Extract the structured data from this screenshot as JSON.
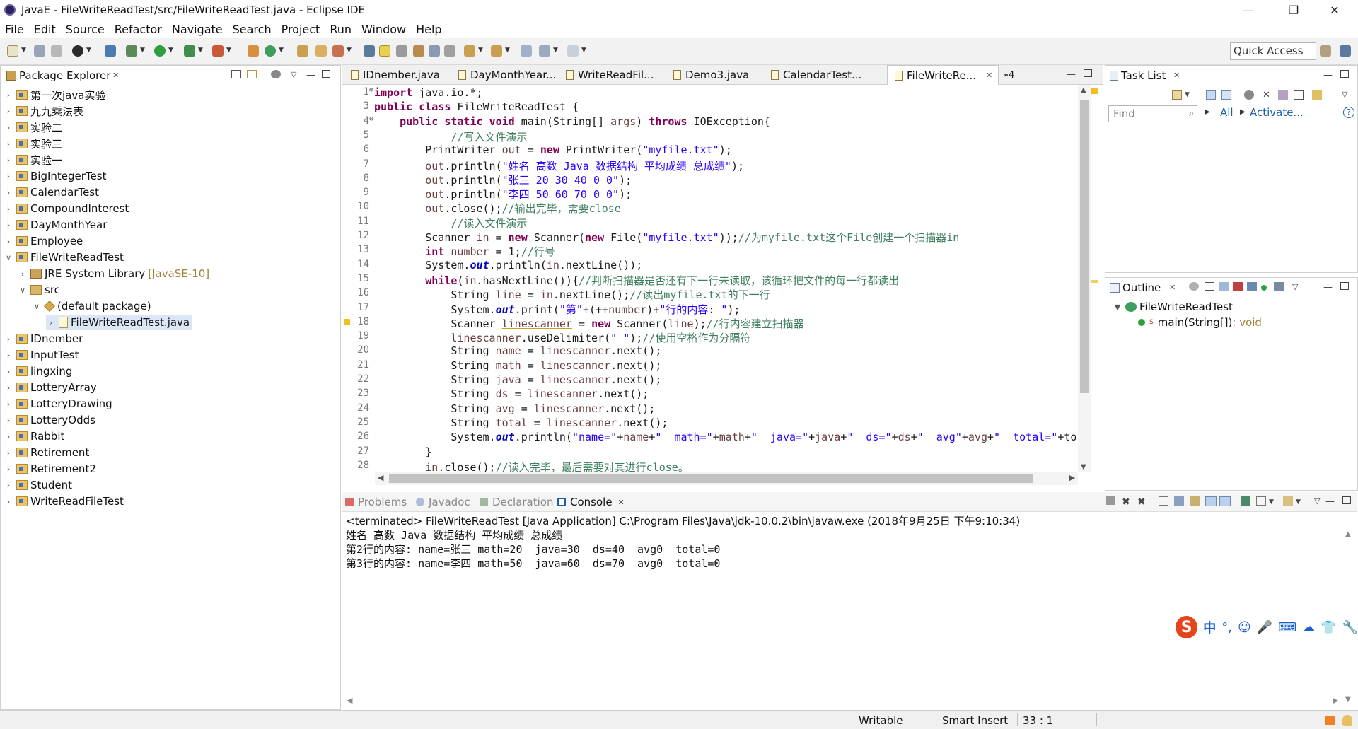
{
  "window": {
    "title": "JavaE - FileWriteReadTest/src/FileWriteReadTest.java - Eclipse IDE",
    "minimize": "—",
    "restore": "❐",
    "close": "✕"
  },
  "menu": [
    "File",
    "Edit",
    "Source",
    "Refactor",
    "Navigate",
    "Search",
    "Project",
    "Run",
    "Window",
    "Help"
  ],
  "quick_access": "Quick Access",
  "package_explorer": {
    "title": "Package Explorer",
    "items": [
      {
        "label": "第一次java实验",
        "kind": "project",
        "level": 0,
        "expanded": false
      },
      {
        "label": "九九乘法表",
        "kind": "project",
        "level": 0,
        "expanded": false
      },
      {
        "label": "实验二",
        "kind": "project",
        "level": 0,
        "expanded": false
      },
      {
        "label": "实验三",
        "kind": "project",
        "level": 0,
        "expanded": false
      },
      {
        "label": "实验一",
        "kind": "project",
        "level": 0,
        "expanded": false
      },
      {
        "label": "BigIntegerTest",
        "kind": "project",
        "level": 0,
        "expanded": false
      },
      {
        "label": "CalendarTest",
        "kind": "project",
        "level": 0,
        "expanded": false
      },
      {
        "label": "CompoundInterest",
        "kind": "project",
        "level": 0,
        "expanded": false
      },
      {
        "label": "DayMonthYear",
        "kind": "project",
        "level": 0,
        "expanded": false
      },
      {
        "label": "Employee",
        "kind": "project",
        "level": 0,
        "expanded": false
      },
      {
        "label": "FileWriteReadTest",
        "kind": "project",
        "level": 0,
        "expanded": true
      },
      {
        "label": "JRE System Library",
        "tag": "[JavaSE-10]",
        "kind": "library",
        "level": 1,
        "expanded": false
      },
      {
        "label": "src",
        "kind": "src",
        "level": 1,
        "expanded": true
      },
      {
        "label": "(default package)",
        "kind": "package",
        "level": 2,
        "expanded": true
      },
      {
        "label": "FileWriteReadTest.java",
        "kind": "java",
        "level": 3,
        "expanded": false,
        "selected": true
      },
      {
        "label": "IDnember",
        "kind": "project",
        "level": 0,
        "expanded": false
      },
      {
        "label": "InputTest",
        "kind": "project",
        "level": 0,
        "expanded": false
      },
      {
        "label": "lingxing",
        "kind": "project",
        "level": 0,
        "expanded": false
      },
      {
        "label": "LotteryArray",
        "kind": "project",
        "level": 0,
        "expanded": false
      },
      {
        "label": "LotteryDrawing",
        "kind": "project",
        "level": 0,
        "expanded": false
      },
      {
        "label": "LotteryOdds",
        "kind": "project",
        "level": 0,
        "expanded": false
      },
      {
        "label": "Rabbit",
        "kind": "project",
        "level": 0,
        "expanded": false
      },
      {
        "label": "Retirement",
        "kind": "project",
        "level": 0,
        "expanded": false
      },
      {
        "label": "Retirement2",
        "kind": "project",
        "level": 0,
        "expanded": false
      },
      {
        "label": "Student",
        "kind": "project",
        "level": 0,
        "expanded": false
      },
      {
        "label": "WriteReadFileTest",
        "kind": "project",
        "level": 0,
        "expanded": false
      }
    ]
  },
  "editor": {
    "tabs": [
      {
        "label": "IDnember.java",
        "active": false
      },
      {
        "label": "DayMonthYear...",
        "active": false
      },
      {
        "label": "WriteReadFil...",
        "active": false
      },
      {
        "label": "Demo3.java",
        "active": false
      },
      {
        "label": "CalendarTest...",
        "active": false
      },
      {
        "label": "FileWriteRe...",
        "active": true
      }
    ],
    "overflow": "»4",
    "lines": [
      {
        "n": "1",
        "marker": "⊕",
        "segs": [
          [
            "kw",
            "import"
          ],
          [
            "",
            " java.io.*;"
          ]
        ]
      },
      {
        "n": "3",
        "segs": [
          [
            "kw",
            "public"
          ],
          [
            "",
            " "
          ],
          [
            "kw",
            "class"
          ],
          [
            "",
            " FileWriteReadTest {"
          ]
        ]
      },
      {
        "n": "4",
        "marker": "⊖",
        "segs": [
          [
            "",
            "    "
          ],
          [
            "kw",
            "public"
          ],
          [
            "",
            " "
          ],
          [
            "kw",
            "static"
          ],
          [
            "",
            " "
          ],
          [
            "kw",
            "void"
          ],
          [
            "",
            " main(String[] "
          ],
          [
            "var",
            "args"
          ],
          [
            "",
            ") "
          ],
          [
            "kw",
            "throws"
          ],
          [
            "",
            " IOException{"
          ]
        ]
      },
      {
        "n": "5",
        "segs": [
          [
            "",
            "            "
          ],
          [
            "cmt",
            "//写入文件演示"
          ]
        ]
      },
      {
        "n": "6",
        "segs": [
          [
            "",
            "        PrintWriter "
          ],
          [
            "var",
            "out"
          ],
          [
            "",
            " = "
          ],
          [
            "kw",
            "new"
          ],
          [
            "",
            " PrintWriter("
          ],
          [
            "str",
            "\"myfile.txt\""
          ],
          [
            "",
            ");"
          ]
        ]
      },
      {
        "n": "7",
        "segs": [
          [
            "",
            "        "
          ],
          [
            "var",
            "out"
          ],
          [
            "",
            ".println("
          ],
          [
            "str",
            "\"姓名 高数 Java 数据结构 平均成绩 总成绩\""
          ],
          [
            "",
            ");"
          ]
        ]
      },
      {
        "n": "8",
        "segs": [
          [
            "",
            "        "
          ],
          [
            "var",
            "out"
          ],
          [
            "",
            ".println("
          ],
          [
            "str",
            "\"张三 20 30 40 0 0\""
          ],
          [
            "",
            ");"
          ]
        ]
      },
      {
        "n": "9",
        "segs": [
          [
            "",
            "        "
          ],
          [
            "var",
            "out"
          ],
          [
            "",
            ".println("
          ],
          [
            "str",
            "\"李四 50 60 70 0 0\""
          ],
          [
            "",
            ");"
          ]
        ]
      },
      {
        "n": "10",
        "segs": [
          [
            "",
            "        "
          ],
          [
            "var",
            "out"
          ],
          [
            "",
            ".close();"
          ],
          [
            "cmt",
            "//输出完毕，需要close"
          ]
        ]
      },
      {
        "n": "11",
        "segs": [
          [
            "",
            "            "
          ],
          [
            "cmt",
            "//读入文件演示"
          ]
        ]
      },
      {
        "n": "12",
        "segs": [
          [
            "",
            "        Scanner "
          ],
          [
            "var",
            "in"
          ],
          [
            "",
            " = "
          ],
          [
            "kw",
            "new"
          ],
          [
            "",
            " Scanner("
          ],
          [
            "kw",
            "new"
          ],
          [
            "",
            " File("
          ],
          [
            "str",
            "\"myfile.txt\""
          ],
          [
            "",
            "));"
          ],
          [
            "cmt",
            "//为myfile.txt这个File创建一个扫描器in"
          ]
        ]
      },
      {
        "n": "13",
        "segs": [
          [
            "",
            "        "
          ],
          [
            "kw",
            "int"
          ],
          [
            "",
            " "
          ],
          [
            "var",
            "number"
          ],
          [
            "",
            " = 1;"
          ],
          [
            "cmt",
            "//行号"
          ]
        ]
      },
      {
        "n": "14",
        "segs": [
          [
            "",
            "        System."
          ],
          [
            "sfld",
            "out"
          ],
          [
            "",
            ".println("
          ],
          [
            "var",
            "in"
          ],
          [
            "",
            ".nextLine());"
          ]
        ]
      },
      {
        "n": "15",
        "segs": [
          [
            "",
            "        "
          ],
          [
            "kw",
            "while"
          ],
          [
            "",
            "("
          ],
          [
            "var",
            "in"
          ],
          [
            "",
            ".hasNextLine()){"
          ],
          [
            "cmt",
            "//判断扫描器是否还有下一行未读取，该循环把文件的每一行都读出"
          ]
        ]
      },
      {
        "n": "16",
        "segs": [
          [
            "",
            "            String "
          ],
          [
            "var",
            "line"
          ],
          [
            "",
            " = "
          ],
          [
            "var",
            "in"
          ],
          [
            "",
            ".nextLine();"
          ],
          [
            "cmt",
            "//读出myfile.txt的下一行"
          ]
        ]
      },
      {
        "n": "17",
        "segs": [
          [
            "",
            "            System."
          ],
          [
            "sfld",
            "out"
          ],
          [
            "",
            ".print("
          ],
          [
            "str",
            "\"第\""
          ],
          [
            "",
            "+(++"
          ],
          [
            "var",
            "number"
          ],
          [
            "",
            ")+"
          ],
          [
            "str",
            "\"行的内容: \""
          ],
          [
            "",
            ");"
          ]
        ]
      },
      {
        "n": "18",
        "warn": true,
        "segs": [
          [
            "",
            "            Scanner "
          ],
          [
            "var warn-u",
            "linescanner"
          ],
          [
            "",
            " = "
          ],
          [
            "kw",
            "new"
          ],
          [
            "",
            " Scanner("
          ],
          [
            "var",
            "line"
          ],
          [
            "",
            ");"
          ],
          [
            "cmt",
            "//行内容建立扫描器"
          ]
        ]
      },
      {
        "n": "19",
        "segs": [
          [
            "",
            "            "
          ],
          [
            "var",
            "linescanner"
          ],
          [
            "",
            ".useDelimiter("
          ],
          [
            "str",
            "\" \""
          ],
          [
            "",
            ");"
          ],
          [
            "cmt",
            "//使用空格作为分隔符"
          ]
        ]
      },
      {
        "n": "20",
        "segs": [
          [
            "",
            "            String "
          ],
          [
            "var",
            "name"
          ],
          [
            "",
            " = "
          ],
          [
            "var",
            "linescanner"
          ],
          [
            "",
            ".next();"
          ]
        ]
      },
      {
        "n": "21",
        "segs": [
          [
            "",
            "            String "
          ],
          [
            "var",
            "math"
          ],
          [
            "",
            " = "
          ],
          [
            "var",
            "linescanner"
          ],
          [
            "",
            ".next();"
          ]
        ]
      },
      {
        "n": "22",
        "segs": [
          [
            "",
            "            String "
          ],
          [
            "var",
            "java"
          ],
          [
            "",
            " = "
          ],
          [
            "var",
            "linescanner"
          ],
          [
            "",
            ".next();"
          ]
        ]
      },
      {
        "n": "23",
        "segs": [
          [
            "",
            "            String "
          ],
          [
            "var",
            "ds"
          ],
          [
            "",
            " = "
          ],
          [
            "var",
            "linescanner"
          ],
          [
            "",
            ".next();"
          ]
        ]
      },
      {
        "n": "24",
        "segs": [
          [
            "",
            "            String "
          ],
          [
            "var",
            "avg"
          ],
          [
            "",
            " = "
          ],
          [
            "var",
            "linescanner"
          ],
          [
            "",
            ".next();"
          ]
        ]
      },
      {
        "n": "25",
        "segs": [
          [
            "",
            "            String "
          ],
          [
            "var",
            "total"
          ],
          [
            "",
            " = "
          ],
          [
            "var",
            "linescanner"
          ],
          [
            "",
            ".next();"
          ]
        ]
      },
      {
        "n": "26",
        "segs": [
          [
            "",
            "            System."
          ],
          [
            "sfld",
            "out"
          ],
          [
            "",
            ".println("
          ],
          [
            "str",
            "\"name=\""
          ],
          [
            "",
            "+"
          ],
          [
            "var",
            "name"
          ],
          [
            "",
            "+"
          ],
          [
            "str",
            "\"  math=\""
          ],
          [
            "",
            "+"
          ],
          [
            "var",
            "math"
          ],
          [
            "",
            "+"
          ],
          [
            "str",
            "\"  java=\""
          ],
          [
            "",
            "+"
          ],
          [
            "var",
            "java"
          ],
          [
            "",
            "+"
          ],
          [
            "str",
            "\"  ds=\""
          ],
          [
            "",
            "+"
          ],
          [
            "var",
            "ds"
          ],
          [
            "",
            "+"
          ],
          [
            "str",
            "\"  avg\""
          ],
          [
            "",
            "+"
          ],
          [
            "var",
            "avg"
          ],
          [
            "",
            "+"
          ],
          [
            "str",
            "\"  total=\""
          ],
          [
            "",
            "+to"
          ]
        ]
      },
      {
        "n": "27",
        "segs": [
          [
            "",
            "        }"
          ]
        ]
      },
      {
        "n": "28",
        "segs": [
          [
            "",
            "        "
          ],
          [
            "var",
            "in"
          ],
          [
            "",
            ".close();"
          ],
          [
            "cmt",
            "//读入完毕，最后需要对其进行close。"
          ]
        ]
      }
    ]
  },
  "task_list": {
    "title": "Task List",
    "find_placeholder": "Find",
    "all": "All",
    "activate": "Activate..."
  },
  "outline": {
    "title": "Outline",
    "class_name": "FileWriteReadTest",
    "method": "main(String[])",
    "method_type": " : void"
  },
  "bottom_tabs": [
    {
      "label": "Problems",
      "active": false,
      "color": "#c04040"
    },
    {
      "label": "Javadoc",
      "active": false,
      "color": "#7a8cc0"
    },
    {
      "label": "Declaration",
      "active": false,
      "color": "#6a8a6a"
    },
    {
      "label": "Console",
      "active": true,
      "color": "#1f5fa8"
    }
  ],
  "console": {
    "header": "<terminated> FileWriteReadTest [Java Application] C:\\Program Files\\Java\\jdk-10.0.2\\bin\\javaw.exe (2018年9月25日 下午9:10:34)",
    "lines": [
      "姓名 高数 Java 数据结构 平均成绩 总成绩",
      "第2行的内容: name=张三 math=20  java=30  ds=40  avg0  total=0",
      "第3行的内容: name=李四 math=50  java=60  ds=70  avg0  total=0"
    ]
  },
  "status": {
    "writable": "Writable",
    "insert_mode": "Smart Insert",
    "position": "33 : 1"
  },
  "ime": {
    "logo": "S",
    "lang": "中",
    "punct": "°,",
    "emoji": "☺",
    "mic": "🎤",
    "keyboard": "⌨",
    "skin": "☁",
    "tools": "👕",
    "settings": "🔧"
  }
}
